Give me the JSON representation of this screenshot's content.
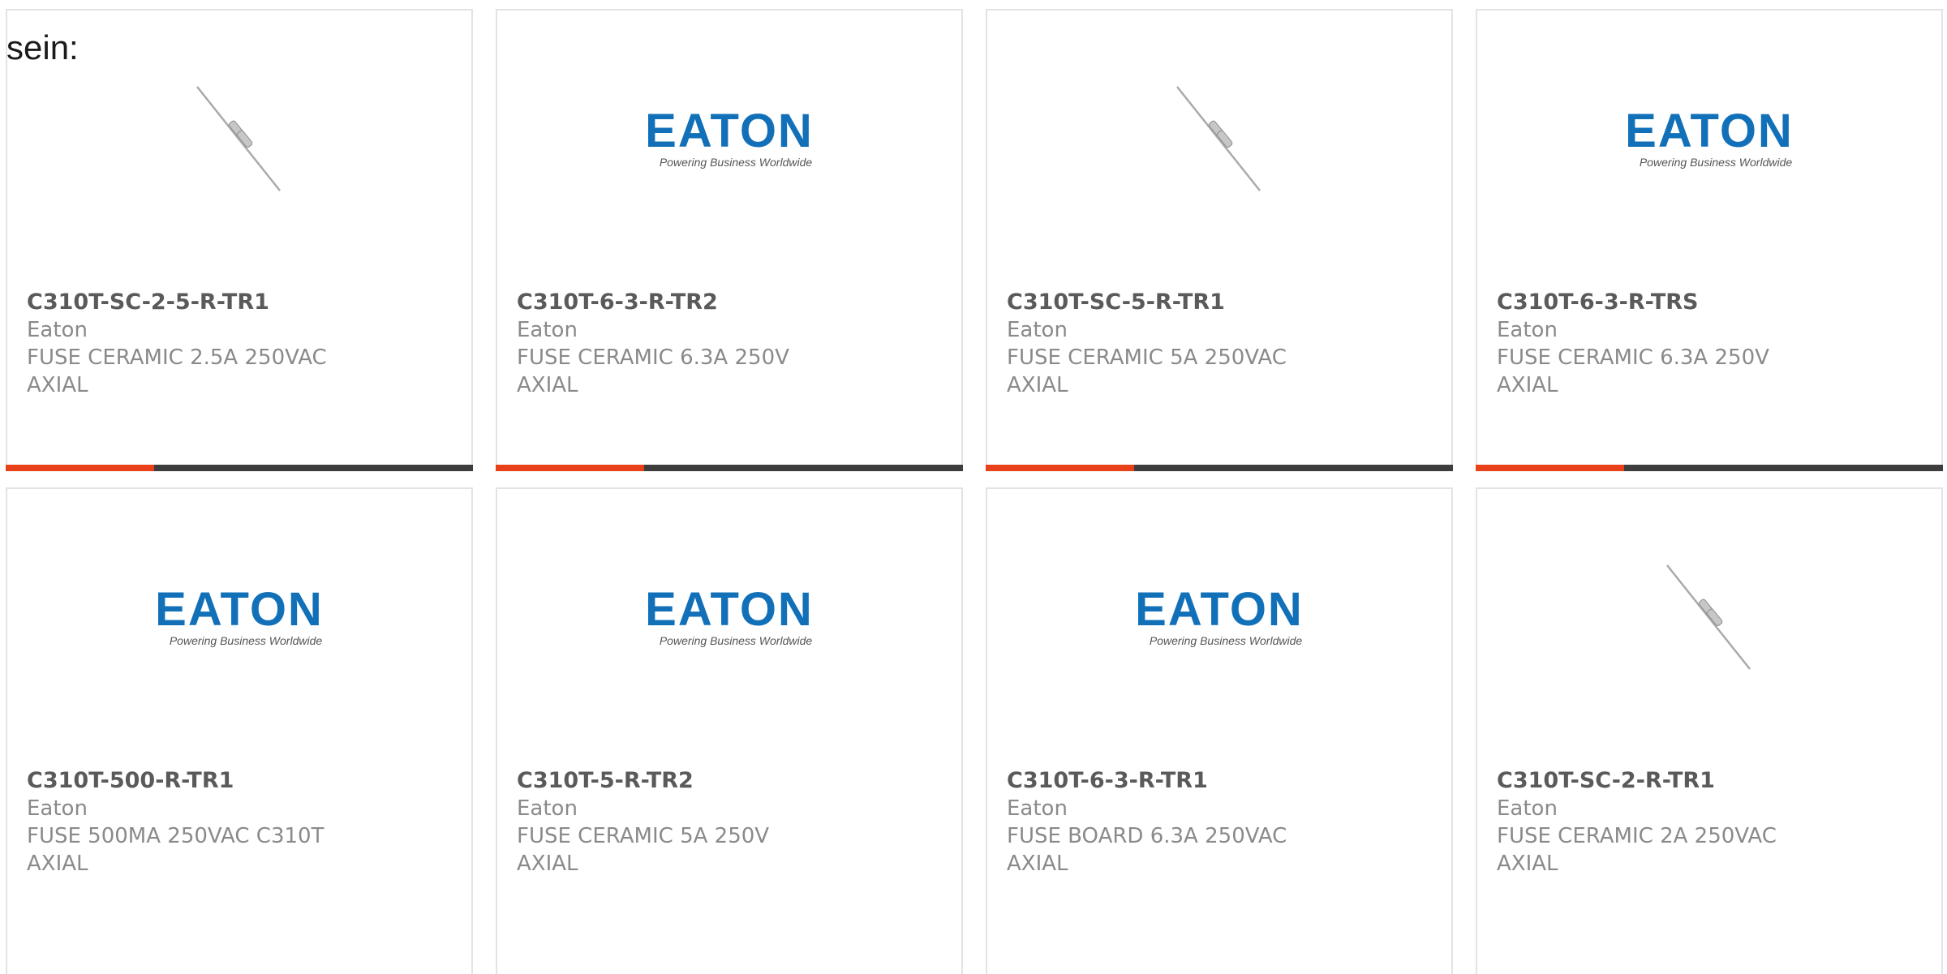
{
  "intro_text": "sein:",
  "products": [
    {
      "part_number": "C310T-SC-2-5-R-TR1",
      "manufacturer": "Eaton",
      "description": "FUSE CERAMIC 2.5A 250VAC AXIAL",
      "image": "axial-fuse-image"
    },
    {
      "part_number": "C310T-6-3-R-TR2",
      "manufacturer": "Eaton",
      "description": "FUSE CERAMIC 6.3A 250V AXIAL",
      "image": "eaton-logo-image"
    },
    {
      "part_number": "C310T-SC-5-R-TR1",
      "manufacturer": "Eaton",
      "description": "FUSE CERAMIC 5A 250VAC AXIAL",
      "image": "axial-fuse-image"
    },
    {
      "part_number": "C310T-6-3-R-TRS",
      "manufacturer": "Eaton",
      "description": "FUSE CERAMIC 6.3A 250V AXIAL",
      "image": "eaton-logo-image"
    },
    {
      "part_number": "C310T-500-R-TR1",
      "manufacturer": "Eaton",
      "description": "FUSE 500MA 250VAC C310T AXIAL",
      "image": "eaton-logo-image"
    },
    {
      "part_number": "C310T-5-R-TR2",
      "manufacturer": "Eaton",
      "description": "FUSE CERAMIC 5A 250V AXIAL",
      "image": "eaton-logo-image"
    },
    {
      "part_number": "C310T-6-3-R-TR1",
      "manufacturer": "Eaton",
      "description": "FUSE BOARD 6.3A 250VAC AXIAL",
      "image": "eaton-logo-image"
    },
    {
      "part_number": "C310T-SC-2-R-TR1",
      "manufacturer": "Eaton",
      "description": "FUSE CERAMIC 2A 250VAC AXIAL",
      "image": "axial-fuse-image"
    }
  ],
  "logo": {
    "wordmark": "EATON",
    "tagline": "Powering Business Worldwide"
  },
  "colors": {
    "accent": "#e8411a",
    "bar": "#3d3d3d",
    "eaton_blue": "#1270b8",
    "border": "#e3e3e3"
  }
}
